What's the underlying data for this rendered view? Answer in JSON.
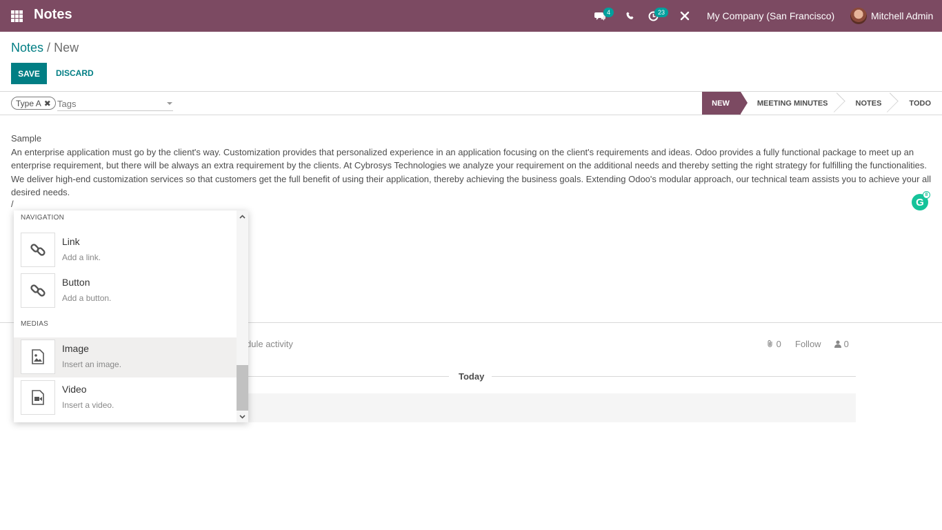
{
  "navbar": {
    "app_title": "Notes",
    "messages_badge": "4",
    "activities_badge": "23",
    "company": "My Company (San Francisco)",
    "user": "Mitchell Admin"
  },
  "breadcrumb": {
    "parent": "Notes",
    "separator": "/",
    "current": "New"
  },
  "actions": {
    "save": "SAVE",
    "discard": "DISCARD"
  },
  "tags": {
    "selected": [
      "Type A"
    ],
    "placeholder": "Tags"
  },
  "stages": [
    "NEW",
    "MEETING MINUTES",
    "NOTES",
    "TODO"
  ],
  "active_stage": "NEW",
  "note": {
    "title": "Sample",
    "body": "An enterprise application must go by the client's way. Customization provides that personalized experience in an application focusing on the client's requirements and ideas. Odoo provides a fully functional package to meet up an enterprise requirement, but there will be always an extra requirement by the clients. At Cybrosys Technologies we analyze your requirement on the additional needs and thereby setting the right strategy for fulfilling the functionalities. We deliver high-end customization services so that customers get the full benefit of using their application, thereby achieving the business goals. Extending Odoo's modular approach, our technical team assists you to achieve your all desired needs.",
    "command_text": "/"
  },
  "grammarly_badge": "8",
  "chatter": {
    "schedule_activity": "dule activity",
    "attachments_count": "0",
    "follow": "Follow",
    "followers_count": "0",
    "today": "Today"
  },
  "palette": {
    "groups": [
      {
        "header": "NAVIGATION",
        "items": [
          {
            "title": "Link",
            "desc": "Add a link.",
            "icon": "link-icon"
          },
          {
            "title": "Button",
            "desc": "Add a button.",
            "icon": "link-icon"
          }
        ]
      },
      {
        "header": "MEDIAS",
        "items": [
          {
            "title": "Image",
            "desc": "Insert an image.",
            "icon": "image-icon"
          },
          {
            "title": "Video",
            "desc": "Insert a video.",
            "icon": "video-icon"
          }
        ]
      }
    ],
    "highlighted": "Image"
  },
  "colors": {
    "navbar": "#7c4a62",
    "primary": "#017e84",
    "badge": "#00a09d"
  }
}
